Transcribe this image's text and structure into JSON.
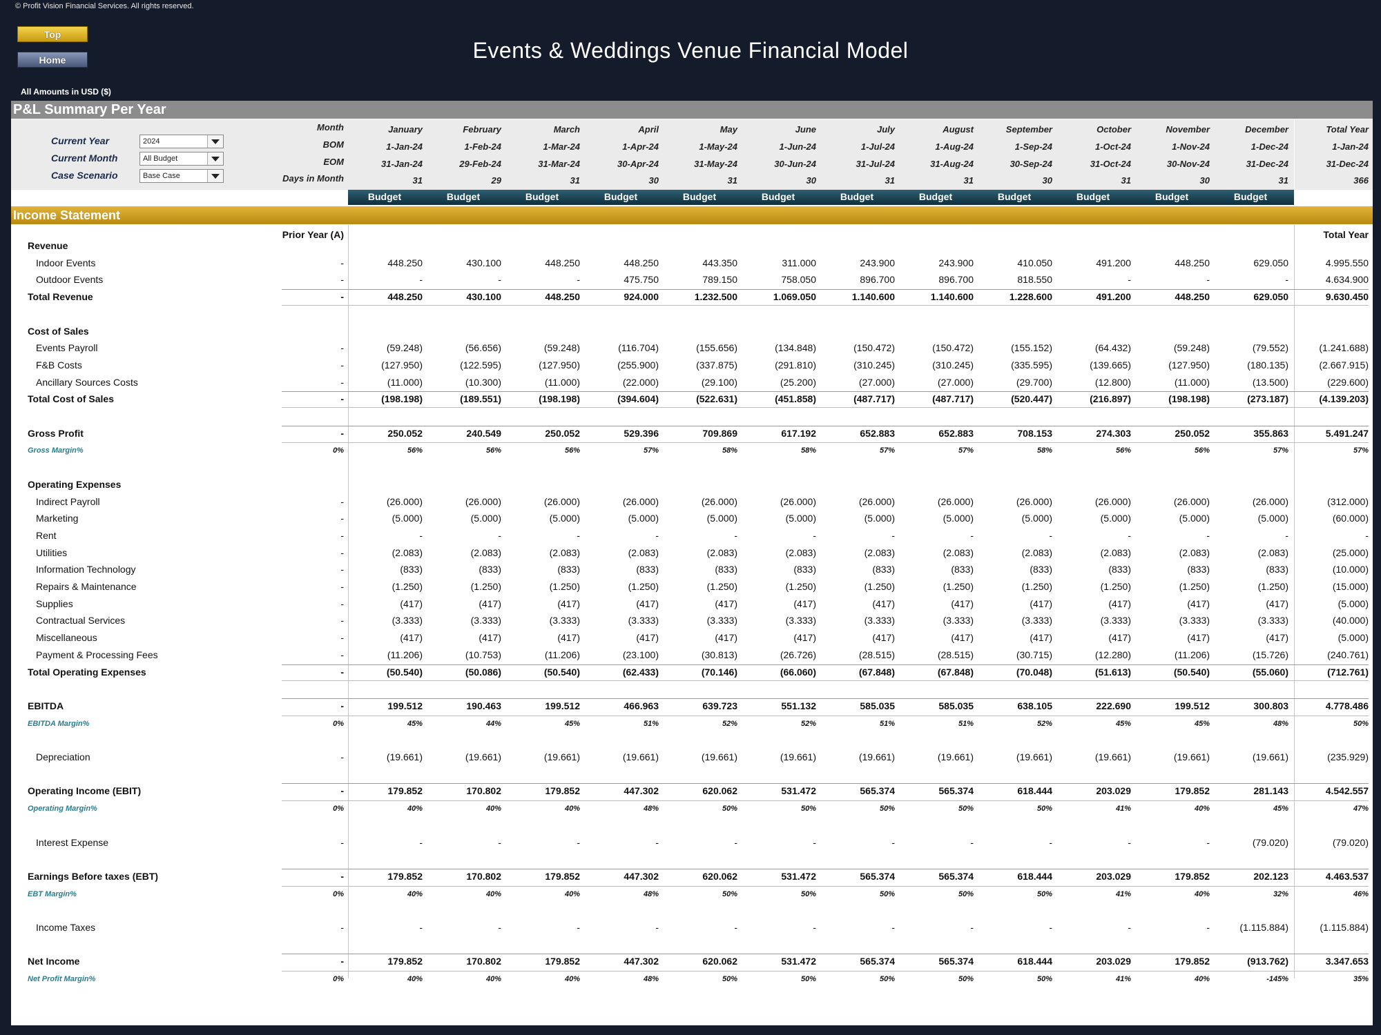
{
  "copyright": "© Profit Vision Financial Services. All rights reserved.",
  "nav": {
    "top_label": "Top",
    "home_label": "Home"
  },
  "title": "Events & Weddings Venue Financial Model",
  "amounts_note": "All Amounts in  USD ($)",
  "pl_section_title": "P&L Summary Per Year",
  "controls": [
    {
      "label": "Current Year",
      "value": "2024"
    },
    {
      "label": "Current Month",
      "value": "All Budget"
    },
    {
      "label": "Case Scenario",
      "value": "Base Case"
    }
  ],
  "header_row_labels": [
    "Month",
    "BOM",
    "EOM",
    "Days in Month"
  ],
  "months": [
    {
      "name": "January",
      "bom": "1-Jan-24",
      "eom": "31-Jan-24",
      "days": "31"
    },
    {
      "name": "February",
      "bom": "1-Feb-24",
      "eom": "29-Feb-24",
      "days": "29"
    },
    {
      "name": "March",
      "bom": "1-Mar-24",
      "eom": "31-Mar-24",
      "days": "31"
    },
    {
      "name": "April",
      "bom": "1-Apr-24",
      "eom": "30-Apr-24",
      "days": "30"
    },
    {
      "name": "May",
      "bom": "1-May-24",
      "eom": "31-May-24",
      "days": "31"
    },
    {
      "name": "June",
      "bom": "1-Jun-24",
      "eom": "30-Jun-24",
      "days": "30"
    },
    {
      "name": "July",
      "bom": "1-Jul-24",
      "eom": "31-Jul-24",
      "days": "31"
    },
    {
      "name": "August",
      "bom": "1-Aug-24",
      "eom": "31-Aug-24",
      "days": "31"
    },
    {
      "name": "September",
      "bom": "1-Sep-24",
      "eom": "30-Sep-24",
      "days": "30"
    },
    {
      "name": "October",
      "bom": "1-Oct-24",
      "eom": "31-Oct-24",
      "days": "31"
    },
    {
      "name": "November",
      "bom": "1-Nov-24",
      "eom": "30-Nov-24",
      "days": "30"
    },
    {
      "name": "December",
      "bom": "1-Dec-24",
      "eom": "31-Dec-24",
      "days": "31"
    }
  ],
  "total_year_header": {
    "name": "Total Year",
    "bom": "1-Jan-24",
    "eom": "31-Dec-24",
    "days": "366"
  },
  "budget_label": "Budget",
  "income_statement_title": "Income Statement",
  "col_prior_year": "Prior Year (A)",
  "col_total_year": "Total Year",
  "rows": [
    {
      "label": "Revenue",
      "type": "section"
    },
    {
      "label": "Indoor Events",
      "type": "item",
      "prior": "-",
      "values": [
        "448.250",
        "430.100",
        "448.250",
        "448.250",
        "443.350",
        "311.000",
        "243.900",
        "243.900",
        "410.050",
        "491.200",
        "448.250",
        "629.050"
      ],
      "total": "4.995.550"
    },
    {
      "label": "Outdoor Events",
      "type": "item",
      "prior": "-",
      "values": [
        "-",
        "-",
        "-",
        "475.750",
        "789.150",
        "758.050",
        "896.700",
        "896.700",
        "818.550",
        "-",
        "-",
        "-"
      ],
      "total": "4.634.900"
    },
    {
      "label": "Total Revenue",
      "type": "total",
      "prior": "-",
      "values": [
        "448.250",
        "430.100",
        "448.250",
        "924.000",
        "1.232.500",
        "1.069.050",
        "1.140.600",
        "1.140.600",
        "1.228.600",
        "491.200",
        "448.250",
        "629.050"
      ],
      "total": "9.630.450"
    },
    {
      "type": "blank"
    },
    {
      "label": "Cost of Sales",
      "type": "section"
    },
    {
      "label": "Events Payroll",
      "type": "item",
      "prior": "-",
      "values": [
        "(59.248)",
        "(56.656)",
        "(59.248)",
        "(116.704)",
        "(155.656)",
        "(134.848)",
        "(150.472)",
        "(150.472)",
        "(155.152)",
        "(64.432)",
        "(59.248)",
        "(79.552)"
      ],
      "total": "(1.241.688)"
    },
    {
      "label": "F&B Costs",
      "type": "item",
      "prior": "-",
      "values": [
        "(127.950)",
        "(122.595)",
        "(127.950)",
        "(255.900)",
        "(337.875)",
        "(291.810)",
        "(310.245)",
        "(310.245)",
        "(335.595)",
        "(139.665)",
        "(127.950)",
        "(180.135)"
      ],
      "total": "(2.667.915)"
    },
    {
      "label": "Ancillary Sources Costs",
      "type": "item",
      "prior": "-",
      "values": [
        "(11.000)",
        "(10.300)",
        "(11.000)",
        "(22.000)",
        "(29.100)",
        "(25.200)",
        "(27.000)",
        "(27.000)",
        "(29.700)",
        "(12.800)",
        "(11.000)",
        "(13.500)"
      ],
      "total": "(229.600)"
    },
    {
      "label": "Total Cost of Sales",
      "type": "total",
      "prior": "-",
      "values": [
        "(198.198)",
        "(189.551)",
        "(198.198)",
        "(394.604)",
        "(522.631)",
        "(451.858)",
        "(487.717)",
        "(487.717)",
        "(520.447)",
        "(216.897)",
        "(198.198)",
        "(273.187)"
      ],
      "total": "(4.139.203)"
    },
    {
      "type": "blank"
    },
    {
      "label": "Gross Profit",
      "type": "key",
      "prior": "-",
      "values": [
        "250.052",
        "240.549",
        "250.052",
        "529.396",
        "709.869",
        "617.192",
        "652.883",
        "652.883",
        "708.153",
        "274.303",
        "250.052",
        "355.863"
      ],
      "total": "5.491.247"
    },
    {
      "label": "Gross Margin%",
      "type": "margin",
      "prior": "0%",
      "values": [
        "56%",
        "56%",
        "56%",
        "57%",
        "58%",
        "58%",
        "57%",
        "57%",
        "58%",
        "56%",
        "56%",
        "57%"
      ],
      "total": "57%"
    },
    {
      "type": "blank"
    },
    {
      "label": "Operating Expenses",
      "type": "section"
    },
    {
      "label": "Indirect Payroll",
      "type": "item",
      "prior": "-",
      "values": [
        "(26.000)",
        "(26.000)",
        "(26.000)",
        "(26.000)",
        "(26.000)",
        "(26.000)",
        "(26.000)",
        "(26.000)",
        "(26.000)",
        "(26.000)",
        "(26.000)",
        "(26.000)"
      ],
      "total": "(312.000)"
    },
    {
      "label": "Marketing",
      "type": "item",
      "prior": "-",
      "values": [
        "(5.000)",
        "(5.000)",
        "(5.000)",
        "(5.000)",
        "(5.000)",
        "(5.000)",
        "(5.000)",
        "(5.000)",
        "(5.000)",
        "(5.000)",
        "(5.000)",
        "(5.000)"
      ],
      "total": "(60.000)"
    },
    {
      "label": "Rent",
      "type": "item",
      "prior": "-",
      "values": [
        "-",
        "-",
        "-",
        "-",
        "-",
        "-",
        "-",
        "-",
        "-",
        "-",
        "-",
        "-"
      ],
      "total": "-"
    },
    {
      "label": "Utilities",
      "type": "item",
      "prior": "-",
      "values": [
        "(2.083)",
        "(2.083)",
        "(2.083)",
        "(2.083)",
        "(2.083)",
        "(2.083)",
        "(2.083)",
        "(2.083)",
        "(2.083)",
        "(2.083)",
        "(2.083)",
        "(2.083)"
      ],
      "total": "(25.000)"
    },
    {
      "label": "Information Technology",
      "type": "item",
      "prior": "-",
      "values": [
        "(833)",
        "(833)",
        "(833)",
        "(833)",
        "(833)",
        "(833)",
        "(833)",
        "(833)",
        "(833)",
        "(833)",
        "(833)",
        "(833)"
      ],
      "total": "(10.000)"
    },
    {
      "label": "Repairs & Maintenance",
      "type": "item",
      "prior": "-",
      "values": [
        "(1.250)",
        "(1.250)",
        "(1.250)",
        "(1.250)",
        "(1.250)",
        "(1.250)",
        "(1.250)",
        "(1.250)",
        "(1.250)",
        "(1.250)",
        "(1.250)",
        "(1.250)"
      ],
      "total": "(15.000)"
    },
    {
      "label": "Supplies",
      "type": "item",
      "prior": "-",
      "values": [
        "(417)",
        "(417)",
        "(417)",
        "(417)",
        "(417)",
        "(417)",
        "(417)",
        "(417)",
        "(417)",
        "(417)",
        "(417)",
        "(417)"
      ],
      "total": "(5.000)"
    },
    {
      "label": "Contractual Services",
      "type": "item",
      "prior": "-",
      "values": [
        "(3.333)",
        "(3.333)",
        "(3.333)",
        "(3.333)",
        "(3.333)",
        "(3.333)",
        "(3.333)",
        "(3.333)",
        "(3.333)",
        "(3.333)",
        "(3.333)",
        "(3.333)"
      ],
      "total": "(40.000)"
    },
    {
      "label": "Miscellaneous",
      "type": "item",
      "prior": "-",
      "values": [
        "(417)",
        "(417)",
        "(417)",
        "(417)",
        "(417)",
        "(417)",
        "(417)",
        "(417)",
        "(417)",
        "(417)",
        "(417)",
        "(417)"
      ],
      "total": "(5.000)"
    },
    {
      "label": "Payment & Processing Fees",
      "type": "item",
      "prior": "-",
      "values": [
        "(11.206)",
        "(10.753)",
        "(11.206)",
        "(23.100)",
        "(30.813)",
        "(26.726)",
        "(28.515)",
        "(28.515)",
        "(30.715)",
        "(12.280)",
        "(11.206)",
        "(15.726)"
      ],
      "total": "(240.761)"
    },
    {
      "label": "Total Operating Expenses",
      "type": "total",
      "prior": "-",
      "values": [
        "(50.540)",
        "(50.086)",
        "(50.540)",
        "(62.433)",
        "(70.146)",
        "(66.060)",
        "(67.848)",
        "(67.848)",
        "(70.048)",
        "(51.613)",
        "(50.540)",
        "(55.060)"
      ],
      "total": "(712.761)"
    },
    {
      "type": "blank"
    },
    {
      "label": "EBITDA",
      "type": "key",
      "prior": "-",
      "values": [
        "199.512",
        "190.463",
        "199.512",
        "466.963",
        "639.723",
        "551.132",
        "585.035",
        "585.035",
        "638.105",
        "222.690",
        "199.512",
        "300.803"
      ],
      "total": "4.778.486"
    },
    {
      "label": "EBITDA Margin%",
      "type": "margin",
      "prior": "0%",
      "values": [
        "45%",
        "44%",
        "45%",
        "51%",
        "52%",
        "52%",
        "51%",
        "51%",
        "52%",
        "45%",
        "45%",
        "48%"
      ],
      "total": "50%"
    },
    {
      "type": "blank"
    },
    {
      "label": "Depreciation",
      "type": "item",
      "prior": "-",
      "values": [
        "(19.661)",
        "(19.661)",
        "(19.661)",
        "(19.661)",
        "(19.661)",
        "(19.661)",
        "(19.661)",
        "(19.661)",
        "(19.661)",
        "(19.661)",
        "(19.661)",
        "(19.661)"
      ],
      "total": "(235.929)"
    },
    {
      "type": "blank"
    },
    {
      "label": "Operating Income (EBIT)",
      "type": "key",
      "prior": "-",
      "values": [
        "179.852",
        "170.802",
        "179.852",
        "447.302",
        "620.062",
        "531.472",
        "565.374",
        "565.374",
        "618.444",
        "203.029",
        "179.852",
        "281.143"
      ],
      "total": "4.542.557"
    },
    {
      "label": "Operating Margin%",
      "type": "margin",
      "prior": "0%",
      "values": [
        "40%",
        "40%",
        "40%",
        "48%",
        "50%",
        "50%",
        "50%",
        "50%",
        "50%",
        "41%",
        "40%",
        "45%"
      ],
      "total": "47%"
    },
    {
      "type": "blank"
    },
    {
      "label": "Interest Expense",
      "type": "item",
      "prior": "-",
      "values": [
        "-",
        "-",
        "-",
        "-",
        "-",
        "-",
        "-",
        "-",
        "-",
        "-",
        "-",
        "(79.020)"
      ],
      "total": "(79.020)"
    },
    {
      "type": "blank"
    },
    {
      "label": "Earnings Before taxes (EBT)",
      "type": "key",
      "prior": "-",
      "values": [
        "179.852",
        "170.802",
        "179.852",
        "447.302",
        "620.062",
        "531.472",
        "565.374",
        "565.374",
        "618.444",
        "203.029",
        "179.852",
        "202.123"
      ],
      "total": "4.463.537"
    },
    {
      "label": "EBT Margin%",
      "type": "margin",
      "prior": "0%",
      "values": [
        "40%",
        "40%",
        "40%",
        "48%",
        "50%",
        "50%",
        "50%",
        "50%",
        "50%",
        "41%",
        "40%",
        "32%"
      ],
      "total": "46%"
    },
    {
      "type": "blank"
    },
    {
      "label": "Income Taxes",
      "type": "item",
      "prior": "-",
      "values": [
        "-",
        "-",
        "-",
        "-",
        "-",
        "-",
        "-",
        "-",
        "-",
        "-",
        "-",
        "(1.115.884)"
      ],
      "total": "(1.115.884)"
    },
    {
      "type": "blank"
    },
    {
      "label": "Net Income",
      "type": "key",
      "prior": "-",
      "values": [
        "179.852",
        "170.802",
        "179.852",
        "447.302",
        "620.062",
        "531.472",
        "565.374",
        "565.374",
        "618.444",
        "203.029",
        "179.852",
        "(913.762)"
      ],
      "total": "3.347.653"
    },
    {
      "label": "Net Profit Margin%",
      "type": "margin",
      "prior": "0%",
      "values": [
        "40%",
        "40%",
        "40%",
        "48%",
        "50%",
        "50%",
        "50%",
        "50%",
        "50%",
        "41%",
        "40%",
        "-145%"
      ],
      "total": "35%"
    }
  ]
}
